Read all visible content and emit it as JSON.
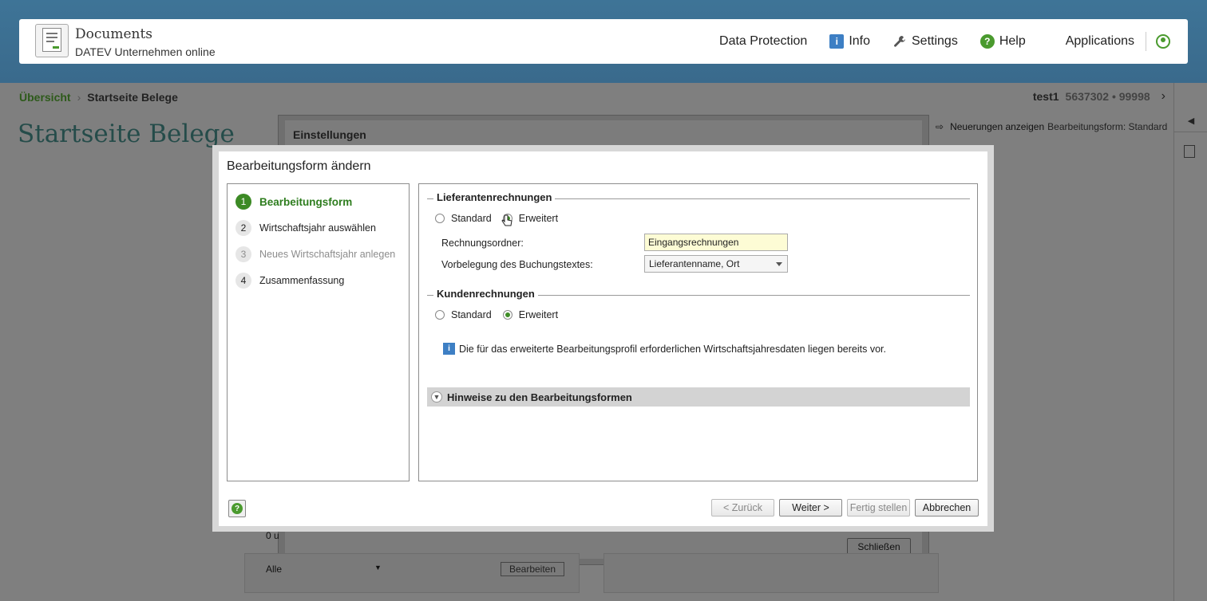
{
  "header": {
    "app_title": "Documents",
    "app_subtitle": "DATEV Unternehmen online",
    "nav": {
      "data_protection": "Data Protection",
      "info": "Info",
      "settings": "Settings",
      "help": "Help",
      "applications": "Applications"
    }
  },
  "breadcrumb": {
    "first": "Übersicht",
    "current": "Startseite Belege"
  },
  "user": {
    "name": "test1",
    "ids": "5637302 • 99998"
  },
  "page": {
    "title": "Startseite Belege",
    "panel_title": "Einstellungen",
    "close_button": "Schließen",
    "news_link": "Neuerungen anzeigen",
    "mode_info": "Bearbeitungsform: Standard",
    "bg_zero": "0 u",
    "bg_filter": "Alle",
    "bg_edit": "Bearbeiten"
  },
  "dialog": {
    "title": "Bearbeitungsform ändern",
    "steps": [
      {
        "num": "1",
        "label": "Bearbeitungsform"
      },
      {
        "num": "2",
        "label": "Wirtschaftsjahr auswählen"
      },
      {
        "num": "3",
        "label": "Neues Wirtschaftsjahr anlegen"
      },
      {
        "num": "4",
        "label": "Zusammenfassung"
      }
    ],
    "supplier": {
      "heading": "Lieferantenrechnungen",
      "opt_standard": "Standard",
      "opt_extended": "Erweitert",
      "selected": "Erweitert",
      "folder_label": "Rechnungsordner:",
      "folder_value": "Eingangsrechnungen",
      "booking_label": "Vorbelegung des Buchungstextes:",
      "booking_value": "Lieferantenname, Ort"
    },
    "customer": {
      "heading": "Kundenrechnungen",
      "opt_standard": "Standard",
      "opt_extended": "Erweitert",
      "selected": "Erweitert"
    },
    "info_text": "Die für das erweiterte Bearbeitungsprofil erforderlichen Wirtschaftsjahresdaten liegen bereits vor.",
    "hints": "Hinweise zu den Bearbeitungsformen",
    "buttons": {
      "back": "< Zurück",
      "next": "Weiter >",
      "finish": "Fertig stellen",
      "cancel": "Abbrechen"
    }
  }
}
